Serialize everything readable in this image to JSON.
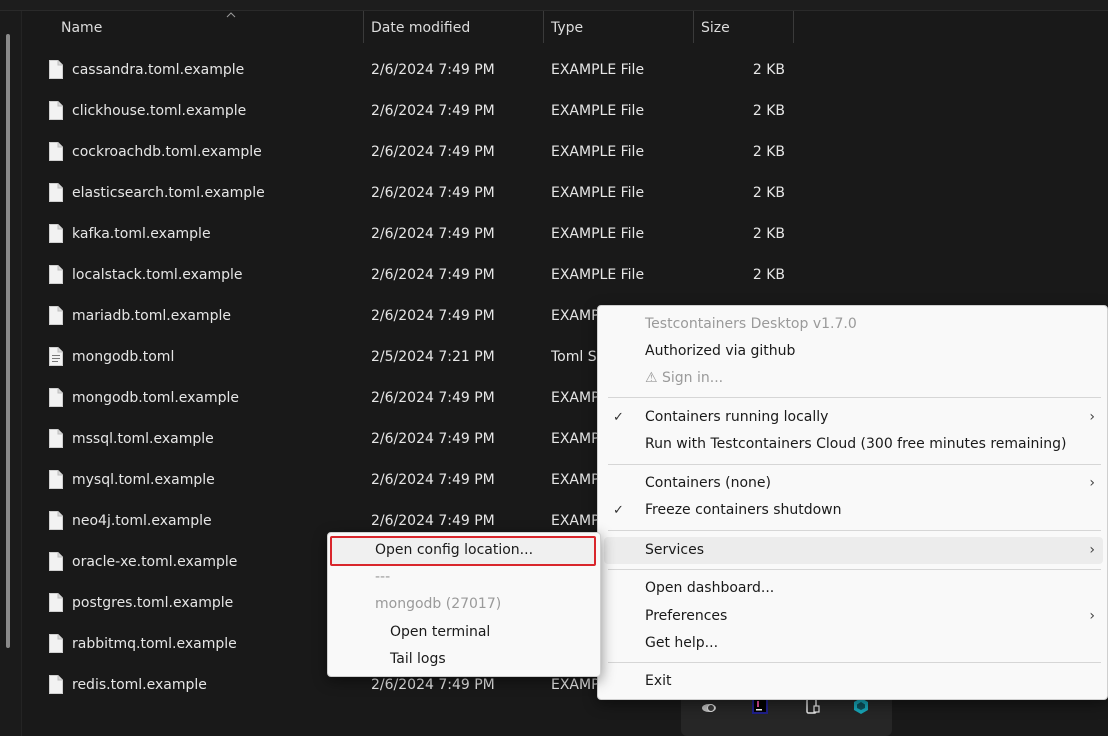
{
  "columns": {
    "name": "Name",
    "date": "Date modified",
    "type": "Type",
    "size": "Size"
  },
  "files": [
    {
      "name": "cassandra.toml.example",
      "date": "2/6/2024 7:49 PM",
      "type": "EXAMPLE File",
      "size": "2 KB"
    },
    {
      "name": "clickhouse.toml.example",
      "date": "2/6/2024 7:49 PM",
      "type": "EXAMPLE File",
      "size": "2 KB"
    },
    {
      "name": "cockroachdb.toml.example",
      "date": "2/6/2024 7:49 PM",
      "type": "EXAMPLE File",
      "size": "2 KB"
    },
    {
      "name": "elasticsearch.toml.example",
      "date": "2/6/2024 7:49 PM",
      "type": "EXAMPLE File",
      "size": "2 KB"
    },
    {
      "name": "kafka.toml.example",
      "date": "2/6/2024 7:49 PM",
      "type": "EXAMPLE File",
      "size": "2 KB"
    },
    {
      "name": "localstack.toml.example",
      "date": "2/6/2024 7:49 PM",
      "type": "EXAMPLE File",
      "size": "2 KB"
    },
    {
      "name": "mariadb.toml.example",
      "date": "2/6/2024 7:49 PM",
      "type": "EXAMPLE File",
      "size": ""
    },
    {
      "name": "mongodb.toml",
      "date": "2/5/2024 7:21 PM",
      "type": "Toml Source File",
      "size": ""
    },
    {
      "name": "mongodb.toml.example",
      "date": "2/6/2024 7:49 PM",
      "type": "EXAMPLE File",
      "size": ""
    },
    {
      "name": "mssql.toml.example",
      "date": "2/6/2024 7:49 PM",
      "type": "EXAMPLE File",
      "size": ""
    },
    {
      "name": "mysql.toml.example",
      "date": "2/6/2024 7:49 PM",
      "type": "EXAMPLE File",
      "size": ""
    },
    {
      "name": "neo4j.toml.example",
      "date": "2/6/2024 7:49 PM",
      "type": "EXAMPLE File",
      "size": ""
    },
    {
      "name": "oracle-xe.toml.example",
      "date": "",
      "type": "",
      "size": ""
    },
    {
      "name": "postgres.toml.example",
      "date": "",
      "type": "",
      "size": ""
    },
    {
      "name": "rabbitmq.toml.example",
      "date": "",
      "type": "",
      "size": ""
    },
    {
      "name": "redis.toml.example",
      "date": "2/6/2024 7:49 PM",
      "type": "EXAMPLE File",
      "size": ""
    }
  ],
  "tray_menu": {
    "app_title": "Testcontainers Desktop v1.7.0",
    "authorized": "Authorized via github",
    "sign_in": "⚠ Sign in...",
    "containers_local": "Containers running locally",
    "run_cloud": "Run with Testcontainers Cloud (300 free minutes remaining)",
    "containers_none": "Containers (none)",
    "freeze": "Freeze containers shutdown",
    "services": "Services",
    "open_dashboard": "Open dashboard...",
    "preferences": "Preferences",
    "get_help": "Get help...",
    "exit": "Exit"
  },
  "services_submenu": {
    "open_config": "Open config location...",
    "separator_text": "---",
    "mongodb_header": "mongodb (27017)",
    "open_terminal": "Open terminal",
    "tail_logs": "Tail logs"
  },
  "glyphs": {
    "check": "✓",
    "chevron": "›"
  },
  "colors": {
    "highlight_border": "#d9262c",
    "background": "#191919",
    "menu_bg": "#f9f9f9"
  },
  "tray_icons": [
    "onedrive-icon",
    "jetbrains-toolbox-icon",
    "phone-link-icon",
    "testcontainers-icon"
  ]
}
